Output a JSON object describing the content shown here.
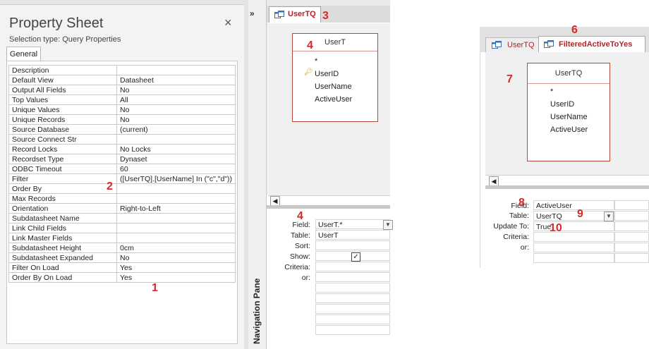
{
  "property_sheet": {
    "title": "Property Sheet",
    "selection_type": "Selection type:  Query Properties",
    "tab_general": "General",
    "close_glyph": "×",
    "rows": [
      {
        "key": "Description",
        "value": ""
      },
      {
        "key": "Default View",
        "value": "Datasheet"
      },
      {
        "key": "Output All Fields",
        "value": "No"
      },
      {
        "key": "Top Values",
        "value": "All"
      },
      {
        "key": "Unique Values",
        "value": "No"
      },
      {
        "key": "Unique Records",
        "value": "No"
      },
      {
        "key": "Source Database",
        "value": "(current)"
      },
      {
        "key": "Source Connect Str",
        "value": ""
      },
      {
        "key": "Record Locks",
        "value": "No Locks"
      },
      {
        "key": "Recordset Type",
        "value": "Dynaset"
      },
      {
        "key": "ODBC Timeout",
        "value": "60"
      },
      {
        "key": "Filter",
        "value": "([UserTQ].[UserName] In (\"c\",\"d\"))"
      },
      {
        "key": "Order By",
        "value": ""
      },
      {
        "key": "Max Records",
        "value": ""
      },
      {
        "key": "Orientation",
        "value": "Right-to-Left"
      },
      {
        "key": "Subdatasheet Name",
        "value": ""
      },
      {
        "key": "Link Child Fields",
        "value": ""
      },
      {
        "key": "Link Master Fields",
        "value": ""
      },
      {
        "key": "Subdatasheet Height",
        "value": "0cm"
      },
      {
        "key": "Subdatasheet Expanded",
        "value": "No"
      },
      {
        "key": "Filter On Load",
        "value": "Yes"
      },
      {
        "key": "Order By On Load",
        "value": "Yes"
      }
    ]
  },
  "nav_pane": {
    "label": "Navigation Pane",
    "expand_glyph": "»"
  },
  "query1": {
    "tab_label": "UserTQ",
    "table": {
      "name": "UserT",
      "fields": [
        "*",
        "UserID",
        "UserName",
        "ActiveUser"
      ]
    },
    "grid": {
      "labels": {
        "field": "Field:",
        "table": "Table:",
        "sort": "Sort:",
        "show": "Show:",
        "criteria": "Criteria:",
        "or": "or:"
      },
      "field_value": "UserT.*",
      "table_value": "UserT"
    }
  },
  "query2": {
    "tab_inactive": "UserTQ",
    "tab_active": "FilteredActiveToYes",
    "table": {
      "name": "UserTQ",
      "fields": [
        "*",
        "UserID",
        "UserName",
        "ActiveUser"
      ]
    },
    "grid": {
      "labels": {
        "field": "Field:",
        "table": "Table:",
        "update_to": "Update To:",
        "criteria": "Criteria:",
        "or": "or:"
      },
      "field_value": "ActiveUser",
      "table_value": "UserTQ",
      "update_value": "True"
    }
  },
  "annotations": [
    "1",
    "2",
    "3",
    "4",
    "4",
    "6",
    "7",
    "8",
    "9",
    "10"
  ],
  "colors": {
    "tab_text": "#b3232b",
    "annotation": "#d42a2a",
    "table_border": "#b8473c"
  }
}
